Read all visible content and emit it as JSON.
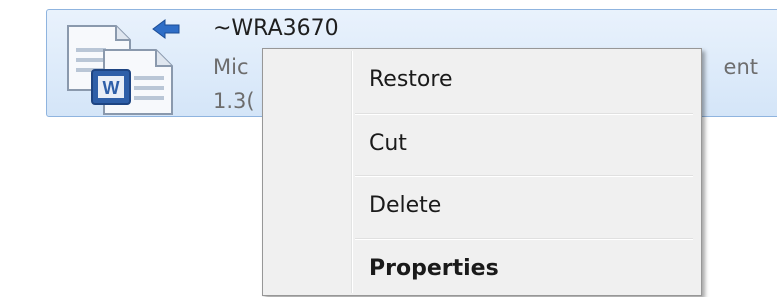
{
  "file": {
    "name": "~WRA3670",
    "type_left": "Mic",
    "type_right": "ent",
    "size": "1.3("
  },
  "icons": {
    "file": "word-documents-icon",
    "restore": "restore-arrow-icon"
  },
  "context_menu": {
    "items": [
      {
        "label": "Restore",
        "bold": false
      },
      {
        "label": "Cut",
        "bold": false
      },
      {
        "label": "Delete",
        "bold": false
      },
      {
        "label": "Properties",
        "bold": true
      }
    ]
  },
  "colors": {
    "selection_border": "#8fb4df",
    "selection_fill": "#d4e5f8",
    "menu_background": "#f0f0f0",
    "arrow_blue": "#2f6ec7"
  }
}
